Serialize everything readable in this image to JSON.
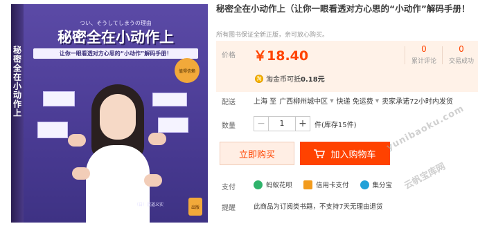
{
  "book_cover": {
    "spine_text": "秘密全在小动作上",
    "top_small": "つい、そうしてしまうの理由",
    "title": "秘密全在小动作上",
    "subtitle": "让你一眼看透对方心思的“小动作”解码手册！",
    "badge": "值得信赖",
    "author": "（日）双道义实",
    "publisher": "出版"
  },
  "product": {
    "title": "秘密全在小动作上（让你一眼看透对方心思的“小动作”解码手册！",
    "note": "所有图书保证全新正版，亲可放心购买。",
    "price_label": "价格",
    "price": "￥18.40",
    "stats": [
      {
        "num": "0",
        "label": "累计评论"
      },
      {
        "num": "0",
        "label": "交易成功"
      }
    ],
    "coin_icon": "淘",
    "coin_text": "淘金币可抵",
    "coin_amount": "0.18元",
    "shipping_label": "配送",
    "shipping_from": "上海 至",
    "shipping_to": "广西柳州城中区",
    "shipping_method": "快递 免运费",
    "shipping_promise": "卖家承诺72小时内发货",
    "quantity_label": "数量",
    "quantity_minus": "−",
    "quantity_value": "1",
    "quantity_plus": "+",
    "stock": "件(库存15件)",
    "buy_now": "立即购买",
    "add_to_cart": "加入购物车",
    "watermark": "yunibaoku.com",
    "watermark2": "云帆宝库网",
    "pay_label": "支付",
    "pay_methods": [
      "蚂蚁花呗",
      "信用卡支付",
      "集分宝"
    ],
    "hint_label": "提醒",
    "hint_text": "此商品为订阅类书籍，不支持7天无理由退货"
  },
  "colors": {
    "accent": "#ff4400",
    "price_bg": "#fff2e8",
    "cart_bg": "#ff4200"
  }
}
